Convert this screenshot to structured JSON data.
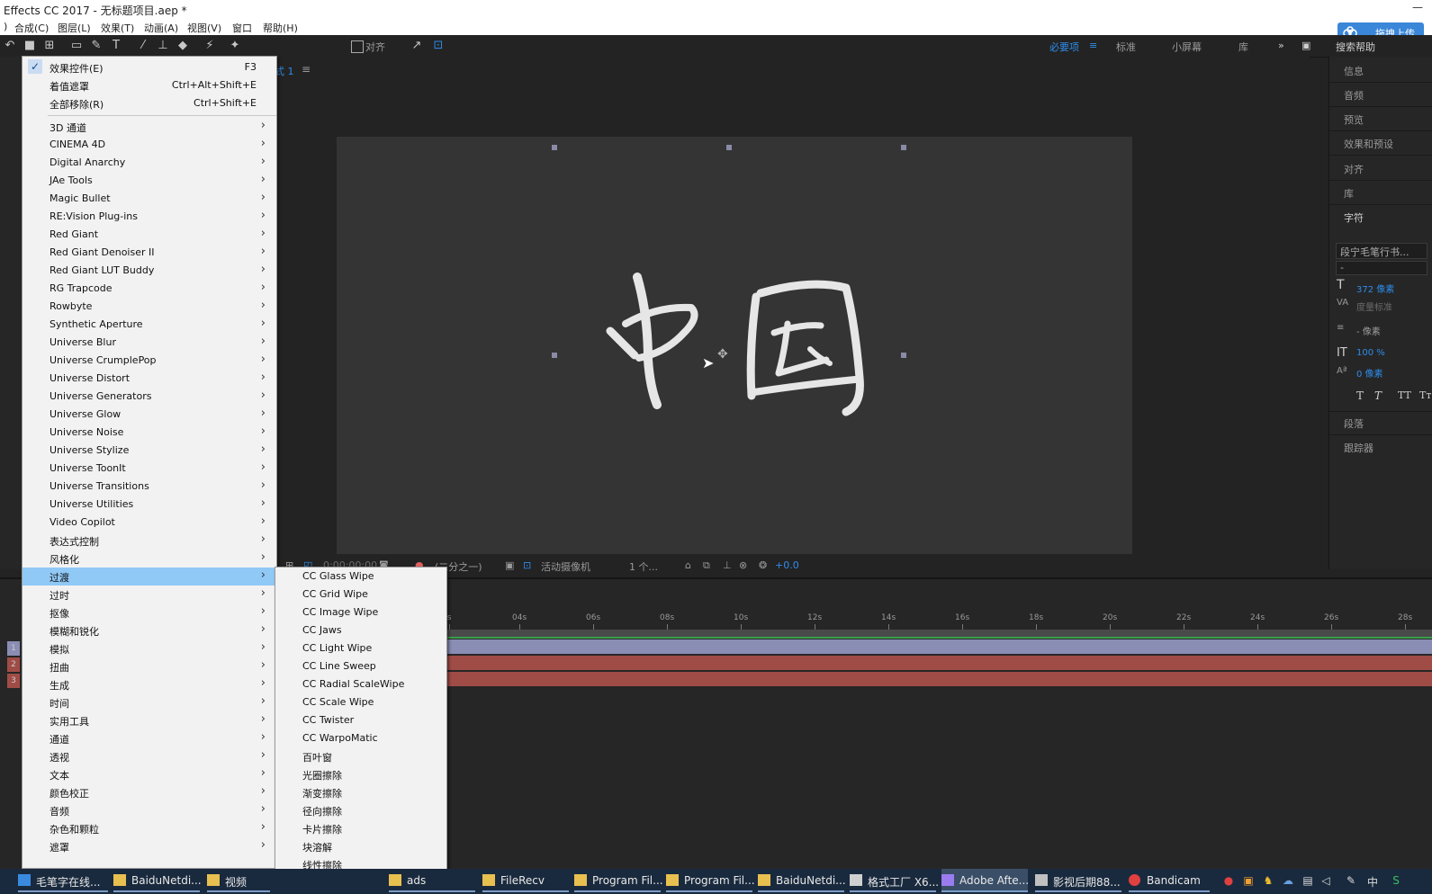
{
  "window": {
    "title": "Effects CC 2017 - 无标题项目.aep *",
    "minimize": "—"
  },
  "menubar": {
    "items": [
      "合成(C)",
      "图层(L)",
      "效果(T)",
      "动画(A)",
      "视图(V)",
      "窗口",
      "帮助(H)"
    ]
  },
  "upload_button": {
    "label": "拖拽上传",
    "icon": "baidu-cloud-icon"
  },
  "toolbar": {
    "snap_label": "对齐",
    "workspaces": [
      "必要项",
      "标准",
      "小屏幕",
      "库"
    ],
    "more": "»",
    "search_placeholder": "搜索帮助"
  },
  "composition": {
    "tab_label": "式 1",
    "text": "中国",
    "viewer_bar": {
      "time": "0:00:00:00",
      "resolution": "(二分之一)",
      "camera": "活动摄像机",
      "views": "1 个...",
      "exposure": "+0.0"
    }
  },
  "right_panel": {
    "items": [
      "信息",
      "音频",
      "预览",
      "效果和预设",
      "对齐",
      "库",
      "字符"
    ],
    "font_name": "段宁毛笔行书...",
    "font_style": "-",
    "font_size": "372 像素",
    "kerning": "度量标准",
    "leading": "- 像素",
    "vertical_scale": "100 %",
    "baseline_shift": "0 像素",
    "lower_items": [
      "段落",
      "跟踪器"
    ]
  },
  "timeline": {
    "ticks": [
      "0s",
      "04s",
      "06s",
      "08s",
      "10s",
      "12s",
      "14s",
      "16s",
      "18s",
      "20s",
      "22s",
      "24s",
      "26s",
      "28s"
    ],
    "layer_numbers": [
      "1",
      "2",
      "3"
    ]
  },
  "effect_menu": {
    "top_items": [
      {
        "label": "效果控件(E)",
        "shortcut": "F3",
        "checked": true
      },
      {
        "label": "着值遮罩",
        "shortcut": "Ctrl+Alt+Shift+E"
      },
      {
        "label": "全部移除(R)",
        "shortcut": "Ctrl+Shift+E"
      }
    ],
    "categories": [
      "3D 通道",
      "CINEMA 4D",
      "Digital Anarchy",
      "JAe Tools",
      "Magic Bullet",
      "RE:Vision Plug-ins",
      "Red Giant",
      "Red Giant Denoiser II",
      "Red Giant LUT Buddy",
      "RG Trapcode",
      "Rowbyte",
      "Synthetic Aperture",
      "Universe Blur",
      "Universe CrumplePop",
      "Universe Distort",
      "Universe Generators",
      "Universe Glow",
      "Universe Noise",
      "Universe Stylize",
      "Universe ToonIt",
      "Universe Transitions",
      "Universe Utilities",
      "Video Copilot",
      "表达式控制",
      "风格化",
      "过渡",
      "过时",
      "抠像",
      "模糊和锐化",
      "模拟",
      "扭曲",
      "生成",
      "时间",
      "实用工具",
      "通道",
      "透视",
      "文本",
      "颜色校正",
      "音频",
      "杂色和颗粒",
      "遮罩"
    ],
    "highlighted": "过渡"
  },
  "transition_submenu": [
    "CC Glass Wipe",
    "CC Grid Wipe",
    "CC Image Wipe",
    "CC Jaws",
    "CC Light Wipe",
    "CC Line Sweep",
    "CC Radial ScaleWipe",
    "CC Scale Wipe",
    "CC Twister",
    "CC WarpoMatic",
    "百叶窗",
    "光圈擦除",
    "渐变擦除",
    "径向擦除",
    "卡片擦除",
    "块溶解",
    "线性擦除"
  ],
  "taskbar": {
    "items": [
      {
        "label": "毛笔字在线...",
        "icon": "ie-icon"
      },
      {
        "label": "BaiduNetdi...",
        "icon": "folder-icon"
      },
      {
        "label": "视频",
        "icon": "folder-icon"
      },
      {
        "label": "ads",
        "icon": "folder-icon"
      },
      {
        "label": "FileRecv",
        "icon": "folder-icon"
      },
      {
        "label": "Program Fil...",
        "icon": "folder-icon"
      },
      {
        "label": "Program Fil...",
        "icon": "folder-icon"
      },
      {
        "label": "BaiduNetdi...",
        "icon": "folder-icon"
      },
      {
        "label": "格式工厂 X6...",
        "icon": "format-factory-icon"
      },
      {
        "label": "Adobe Afte...",
        "icon": "after-effects-icon"
      },
      {
        "label": "影视后期88...",
        "icon": "app-icon"
      },
      {
        "label": "Bandicam",
        "icon": "record-icon"
      }
    ],
    "ime": "中"
  },
  "colors": {
    "accent": "#2d8ceb",
    "menu_highlight": "#90c8f6",
    "layer_purple": "#8a8db4",
    "layer_red": "#a04c46"
  }
}
